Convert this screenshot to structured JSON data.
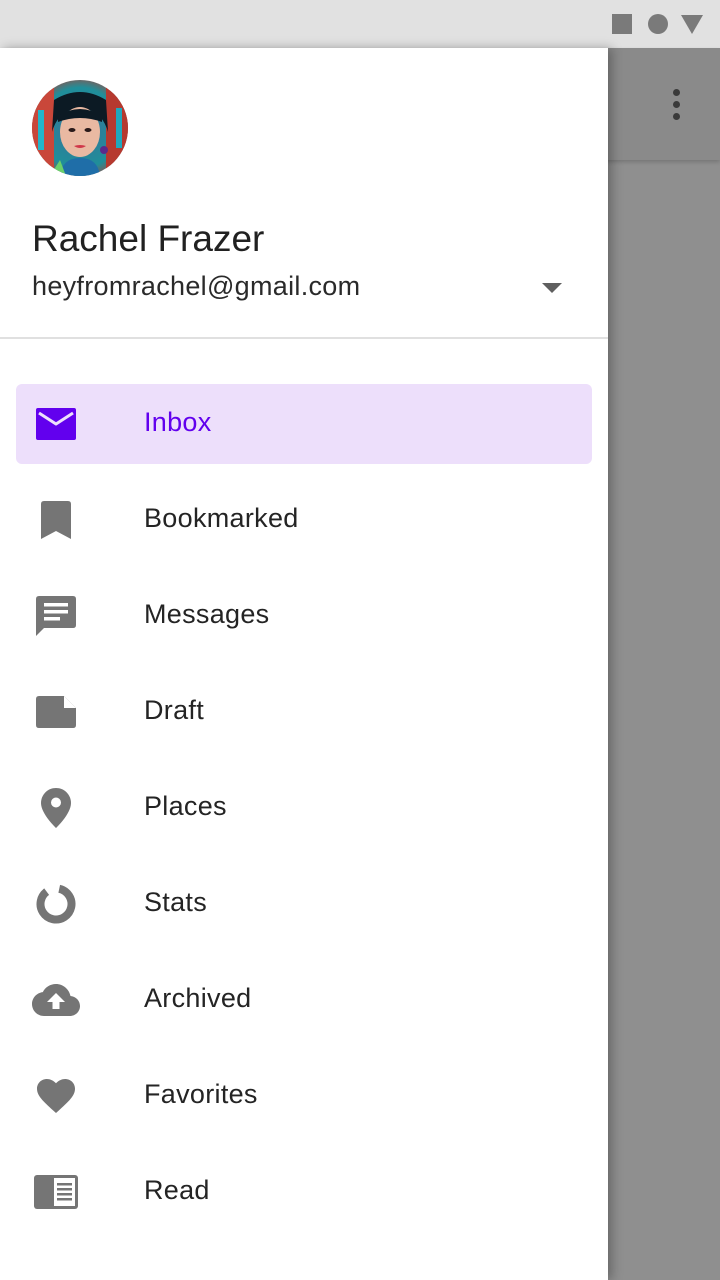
{
  "colors": {
    "accent": "#6200ee",
    "active_bg": "#eddffb",
    "icon": "#757575",
    "status_bar": "#e1e1e1",
    "scrim": "#8f8f8f"
  },
  "status_bar": {
    "icons": [
      "square-icon",
      "circle-icon",
      "triangle-icon"
    ]
  },
  "app_bar": {
    "overflow_icon": "more-vert-icon"
  },
  "account": {
    "name": "Rachel Frazer",
    "email": "heyfromrachel@gmail.com",
    "avatar_icon": "avatar-photo",
    "dropdown_icon": "arrow-drop-down-icon"
  },
  "nav": {
    "active_index": 0,
    "items": [
      {
        "label": "Inbox",
        "icon": "mail-icon"
      },
      {
        "label": "Bookmarked",
        "icon": "bookmark-icon"
      },
      {
        "label": "Messages",
        "icon": "message-icon"
      },
      {
        "label": "Draft",
        "icon": "draft-icon"
      },
      {
        "label": "Places",
        "icon": "place-icon"
      },
      {
        "label": "Stats",
        "icon": "donut-icon"
      },
      {
        "label": "Archived",
        "icon": "cloud-upload-icon"
      },
      {
        "label": "Favorites",
        "icon": "heart-icon"
      },
      {
        "label": "Read",
        "icon": "read-icon"
      }
    ]
  }
}
